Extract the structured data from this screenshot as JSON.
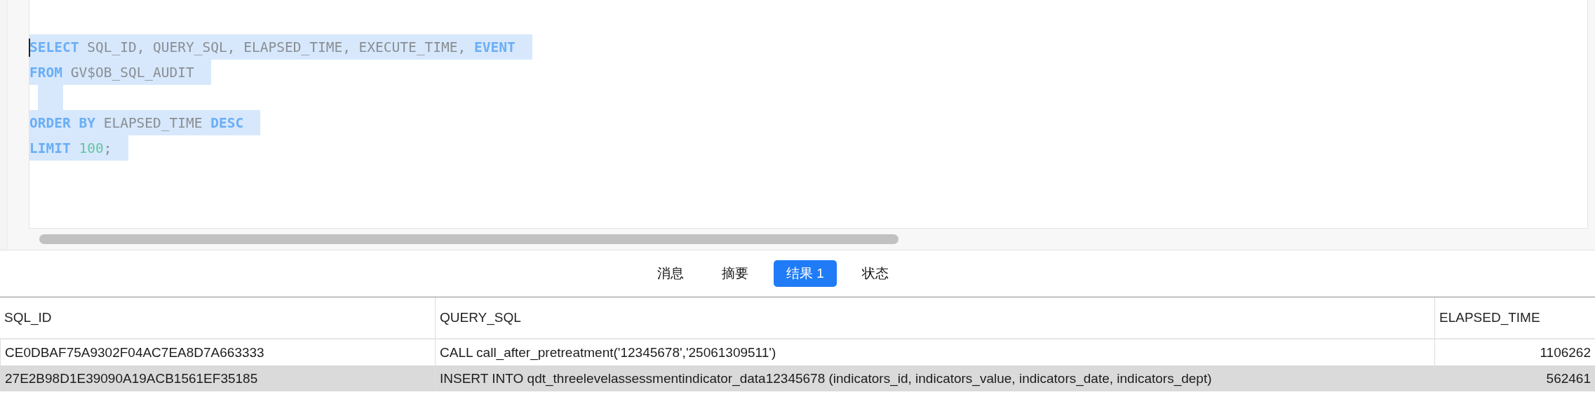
{
  "editor": {
    "lines": [
      [
        {
          "kind": "keyword",
          "text": "SELECT"
        },
        {
          "kind": "plain",
          "text": " SQL_ID, QUERY_SQL, ELAPSED_TIME, EXECUTE_TIME, "
        },
        {
          "kind": "keyword",
          "text": "EVENT"
        }
      ],
      [
        {
          "kind": "keyword",
          "text": "FROM"
        },
        {
          "kind": "plain",
          "text": " GV$OB_SQL_AUDIT"
        }
      ],
      [
        {
          "kind": "blank"
        }
      ],
      [
        {
          "kind": "keyword",
          "text": "ORDER BY"
        },
        {
          "kind": "plain",
          "text": " ELAPSED_TIME "
        },
        {
          "kind": "keyword",
          "text": "DESC"
        }
      ],
      [
        {
          "kind": "keyword",
          "text": "LIMIT"
        },
        {
          "kind": "number",
          "text": " 100"
        },
        {
          "kind": "plain",
          "text": ";"
        }
      ]
    ]
  },
  "tabs": [
    {
      "label": "消息",
      "selected": false
    },
    {
      "label": "摘要",
      "selected": false
    },
    {
      "label": "结果 1",
      "selected": true
    },
    {
      "label": "状态",
      "selected": false
    }
  ],
  "table": {
    "columns": [
      "SQL_ID",
      "QUERY_SQL",
      "ELAPSED_TIME"
    ],
    "rows": [
      {
        "selected": false,
        "cells": [
          "CE0DBAF75A9302F04AC7EA8D7A663333",
          "CALL call_after_pretreatment('12345678','25061309511')",
          "1106262"
        ]
      },
      {
        "selected": true,
        "cells": [
          "27E2B98D1E39090A19ACB1561EF35185",
          "INSERT INTO qdt_threelevelassessmentindicator_data12345678 (indicators_id, indicators_value, indicators_date, indicators_dept)",
          "562461"
        ]
      }
    ]
  }
}
